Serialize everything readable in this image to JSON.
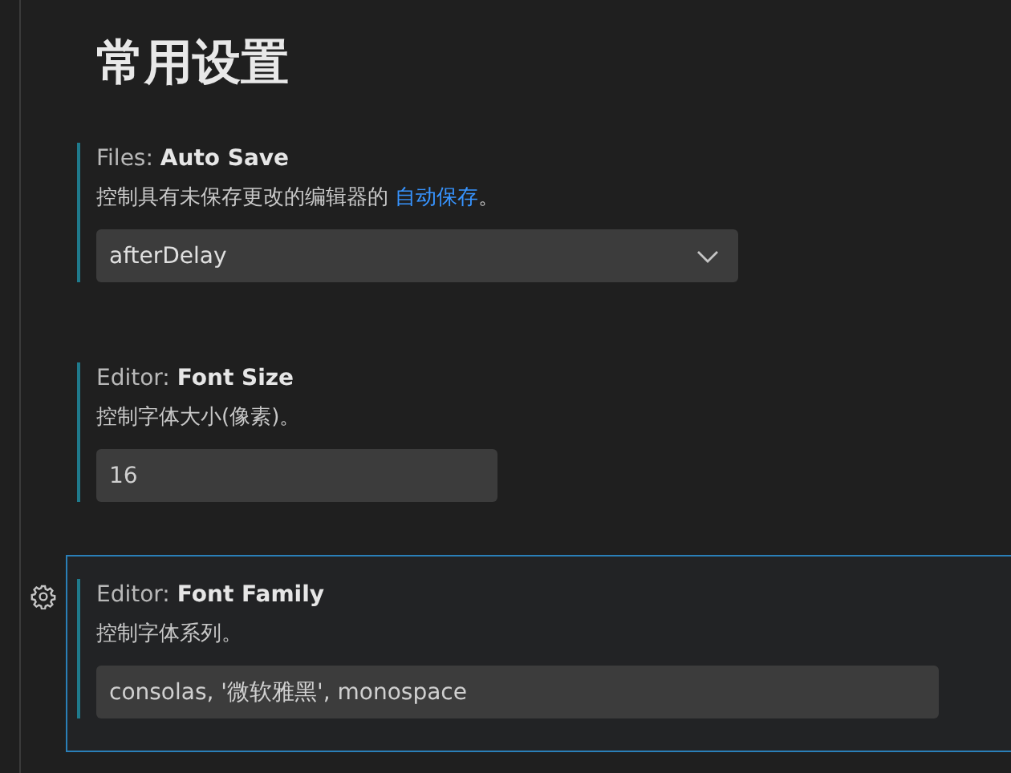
{
  "heading": "常用设置",
  "settings": [
    {
      "kind": "dropdown",
      "focused": false,
      "category": "Files: ",
      "name": "Auto Save",
      "description": "控制具有未保存更改的编辑器的 ",
      "link": "自动保存",
      "description_end": "。",
      "value": "afterDelay"
    },
    {
      "kind": "input",
      "focused": false,
      "category": "Editor: ",
      "name": "Font Size",
      "description": "控制字体大小(像素)。",
      "value": "16"
    },
    {
      "kind": "input_wide",
      "focused": true,
      "category": "Editor: ",
      "name": "Font Family",
      "description": "控制字体系列。",
      "value": "consolas, '微软雅黑', monospace"
    }
  ]
}
